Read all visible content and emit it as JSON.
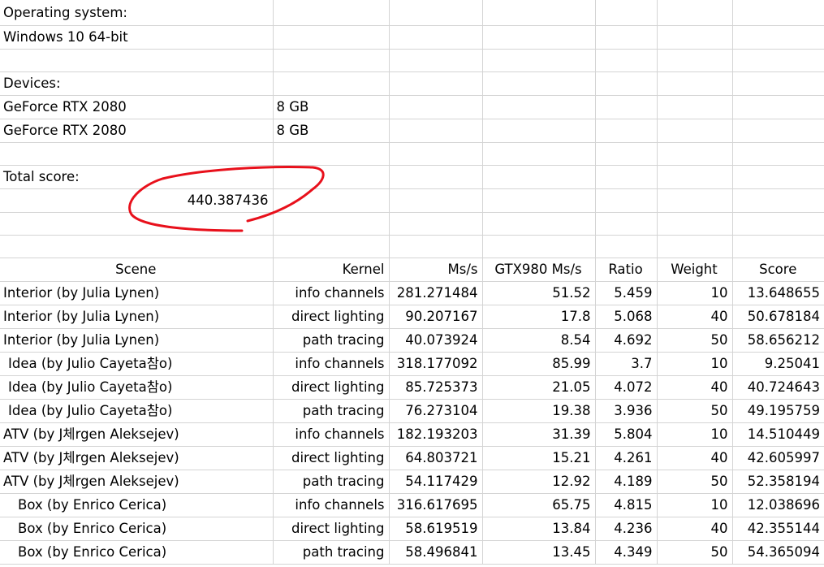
{
  "info": {
    "os_label": "Operating system:",
    "os_value": "Windows 10 64-bit",
    "devices_label": "Devices:",
    "devices": [
      {
        "name": "GeForce RTX 2080",
        "memory": "8 GB"
      },
      {
        "name": "GeForce RTX 2080",
        "memory": "8 GB"
      }
    ],
    "total_label": "Total score:",
    "total_value": "440.387436"
  },
  "table": {
    "headers": [
      "Scene",
      "Kernel",
      "Ms/s",
      "GTX980 Ms/s",
      "Ratio",
      "Weight",
      "Score"
    ],
    "rows": [
      [
        "Interior (by Julia Lynen)",
        "info channels",
        "281.271484",
        "51.52",
        "5.459",
        "10",
        "13.648655"
      ],
      [
        "Interior (by Julia Lynen)",
        "direct lighting",
        "90.207167",
        "17.8",
        "5.068",
        "40",
        "50.678184"
      ],
      [
        "Interior (by Julia Lynen)",
        "path tracing",
        "40.073924",
        "8.54",
        "4.692",
        "50",
        "58.656212"
      ],
      [
        "Idea (by Julio Cayeta참o)",
        "info channels",
        "318.177092",
        "85.99",
        "3.7",
        "10",
        "9.25041"
      ],
      [
        "Idea (by Julio Cayeta참o)",
        "direct lighting",
        "85.725373",
        "21.05",
        "4.072",
        "40",
        "40.724643"
      ],
      [
        "Idea (by Julio Cayeta참o)",
        "path tracing",
        "76.273104",
        "19.38",
        "3.936",
        "50",
        "49.195759"
      ],
      [
        "ATV (by J체rgen Aleksejev)",
        "info channels",
        "182.193203",
        "31.39",
        "5.804",
        "10",
        "14.510449"
      ],
      [
        "ATV (by J체rgen Aleksejev)",
        "direct lighting",
        "64.803721",
        "15.21",
        "4.261",
        "40",
        "42.605997"
      ],
      [
        "ATV (by J체rgen Aleksejev)",
        "path tracing",
        "54.117429",
        "12.92",
        "4.189",
        "50",
        "52.358194"
      ],
      [
        "Box (by Enrico Cerica)",
        "info channels",
        "316.617695",
        "65.75",
        "4.815",
        "10",
        "12.038696"
      ],
      [
        "Box (by Enrico Cerica)",
        "direct lighting",
        "58.619519",
        "13.84",
        "4.236",
        "40",
        "42.355144"
      ],
      [
        "Box (by Enrico Cerica)",
        "path tracing",
        "58.496841",
        "13.45",
        "4.349",
        "50",
        "54.365094"
      ]
    ]
  },
  "colors": {
    "gridline": "#d4d4d4",
    "annotation": "#e8101b"
  }
}
